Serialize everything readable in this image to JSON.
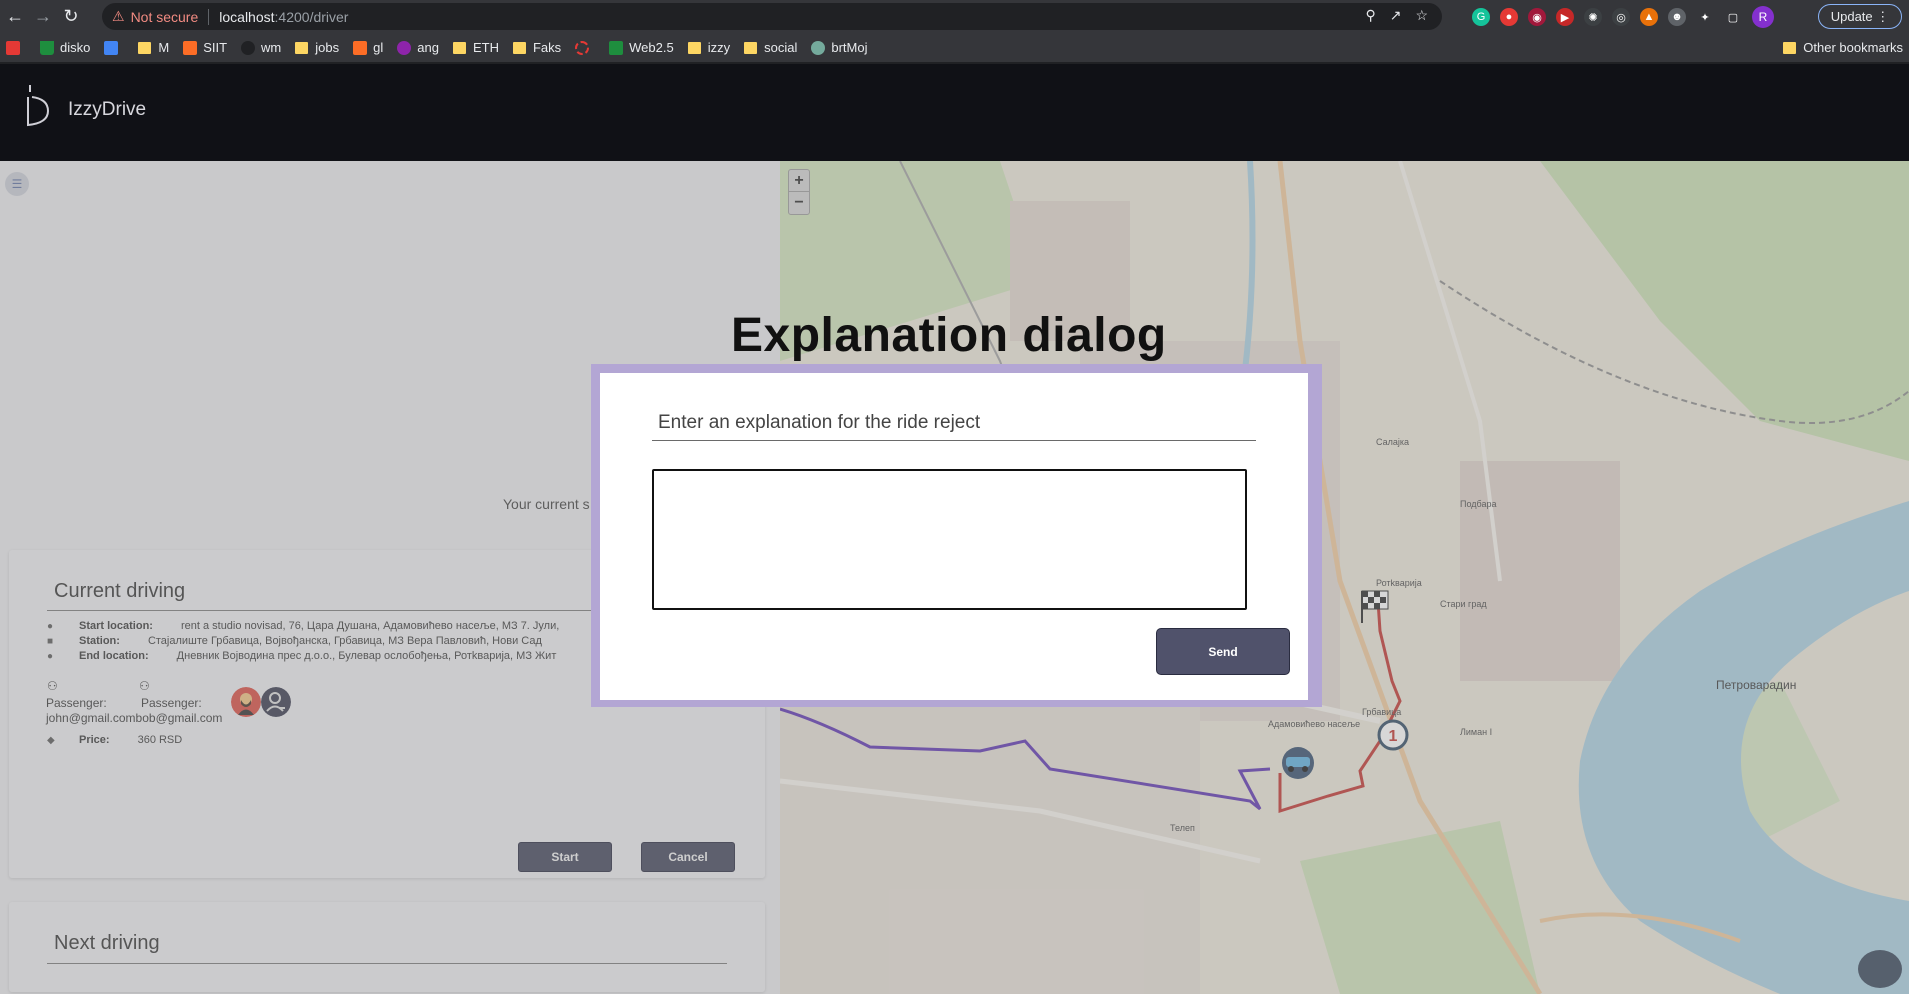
{
  "browser": {
    "not_secure": "Not secure",
    "url_host": "localhost",
    "url_path": ":4200/driver",
    "update_label": "Update",
    "profile_initial": "R",
    "bookmarks": [
      "disko",
      "M",
      "SIIT",
      "wm",
      "jobs",
      "gl",
      "ang",
      "ETH",
      "Faks",
      "Web2.5",
      "izzy",
      "social",
      "brtMoj"
    ],
    "other_bookmarks": "Other bookmarks"
  },
  "app": {
    "brand": "IzzyDrive"
  },
  "left": {
    "status_text": "Your current s",
    "current": {
      "title": "Current driving",
      "start_label": "Start location:",
      "start_value": "rent a studio novisad, 76, Цара Душана, Адамовићево насеље, МЗ 7. Јули,",
      "station_label": "Station:",
      "station_value": "Стајалиште Грбавица, Војвођанска, Грбавица, МЗ Вера Павловић, Нови Сад",
      "end_label": "End location:",
      "end_value": "Дневник Војводина прес д.о.о., Булевар ослобођења, Ротkварија, МЗ Жит",
      "passenger_label_1": "Passenger:",
      "passenger_label_2": "Passenger:",
      "passenger_emails": "john@gmail.combob@gmail.com",
      "price_label": "Price:",
      "price_value": "360 RSD",
      "start_button": "Start",
      "cancel_button": "Cancel"
    },
    "next": {
      "title": "Next driving"
    }
  },
  "map": {
    "zoom_in": "+",
    "zoom_out": "−",
    "labels": {
      "petrovaradin": "Петроварадин",
      "grbavica": "Грбавица",
      "adamovicevo": "Адамовићево насеље",
      "rotkvarija": "Ротkварија",
      "liman": "Лиман I",
      "telep": "Телеп",
      "salajka": "Салајка",
      "podbara": "Подбара",
      "staro": "Стари град"
    },
    "route_marker_number": "1"
  },
  "dialog": {
    "heading": "Explanation dialog",
    "prompt": "Enter an explanation for the ride reject",
    "textarea_value": "",
    "send_button": "Send"
  },
  "colors": {
    "accent_dark": "#3c3f56",
    "dialog_frame": "#b3a6d4",
    "route_red": "#c0302a",
    "route_purple": "#5a2fb0"
  }
}
